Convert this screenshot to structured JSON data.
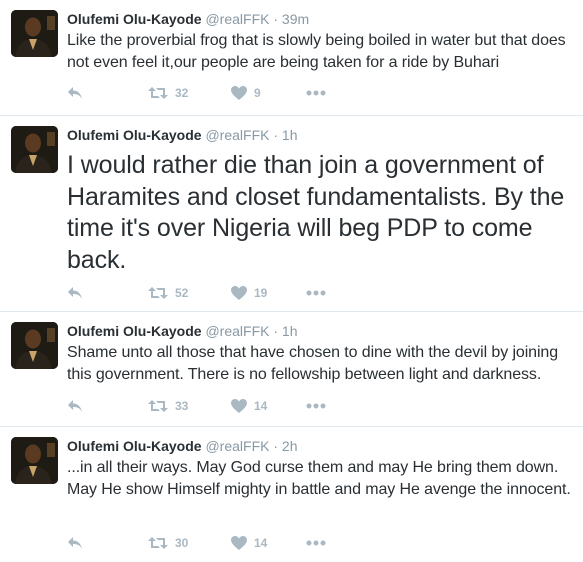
{
  "tweets": [
    {
      "fullname": "Olufemi Olu-Kayode",
      "username": "@realFFK",
      "time": "39m",
      "text": "Like the proverbial frog that is slowly being boiled in water but that does not even feel it,our people are being taken for a ride by Buhari",
      "retweets": "32",
      "likes": "9"
    },
    {
      "fullname": "Olufemi Olu-Kayode",
      "username": "@realFFK",
      "time": "1h",
      "text": "I would rather die than join a government of Haramites and closet fundamentalists. By the time it's over Nigeria will beg PDP to come back.",
      "retweets": "52",
      "likes": "19"
    },
    {
      "fullname": "Olufemi Olu-Kayode",
      "username": "@realFFK",
      "time": "1h",
      "text": "Shame unto all those that have chosen to dine with the devil by joining this government. There is no fellowship between light and darkness.",
      "retweets": "33",
      "likes": "14"
    },
    {
      "fullname": "Olufemi Olu-Kayode",
      "username": "@realFFK",
      "time": "2h",
      "text": "...in all their ways. May God curse them and may He bring them down. May He show Himself mighty in battle and may He avenge the innocent.",
      "retweets": "30",
      "likes": "14"
    }
  ],
  "separator": "·",
  "icons": {
    "reply": "reply-icon",
    "retweet": "retweet-icon",
    "like": "heart-icon",
    "more": "more-dots-icon"
  },
  "colors": {
    "name": "#292f33",
    "muted": "#8899a6",
    "action": "#aab8c2",
    "divider": "#e1e8ed"
  }
}
